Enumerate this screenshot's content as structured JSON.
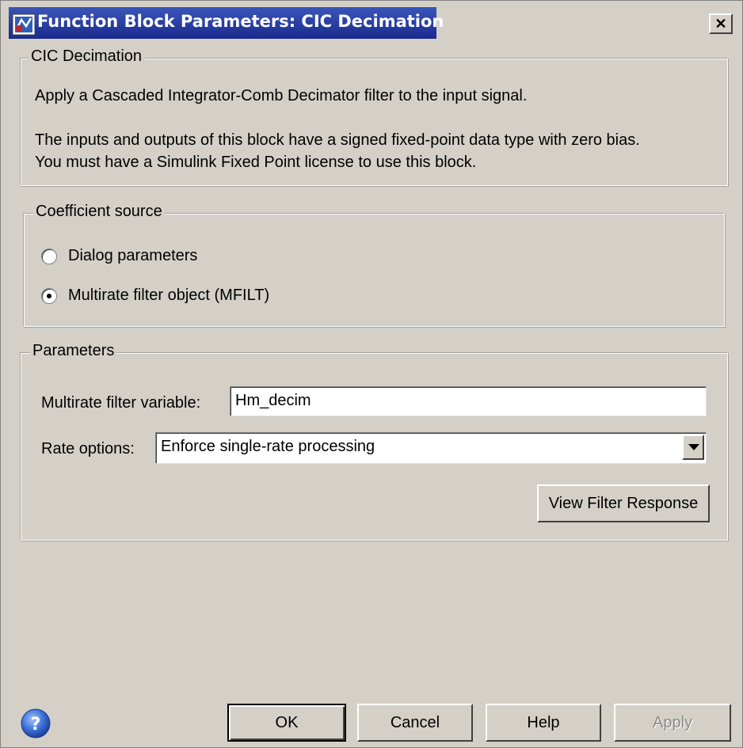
{
  "window": {
    "title": "Function Block Parameters: CIC Decimation",
    "close_label": "✕"
  },
  "description": {
    "group_title": "CIC Decimation",
    "line1": "Apply a Cascaded Integrator-Comb Decimator filter to the input signal.",
    "line2": "The inputs and outputs of this block have a signed fixed-point data type with zero bias.",
    "line3": "You must have a Simulink Fixed Point license to use this block."
  },
  "coefficient_source": {
    "group_title": "Coefficient source",
    "options": [
      {
        "label": "Dialog parameters",
        "selected": false
      },
      {
        "label": "Multirate filter object (MFILT)",
        "selected": true
      }
    ]
  },
  "parameters": {
    "group_title": "Parameters",
    "filter_variable_label": "Multirate filter variable:",
    "filter_variable_value": "Hm_decim",
    "rate_options_label": "Rate options:",
    "rate_options_value": "Enforce single-rate processing",
    "view_response_label": "View Filter Response"
  },
  "footer": {
    "ok_label": "OK",
    "cancel_label": "Cancel",
    "help_label": "Help",
    "apply_label": "Apply"
  },
  "colors": {
    "dialog_bg": "#d4d0c8",
    "title_bar": "#1c2f96"
  }
}
